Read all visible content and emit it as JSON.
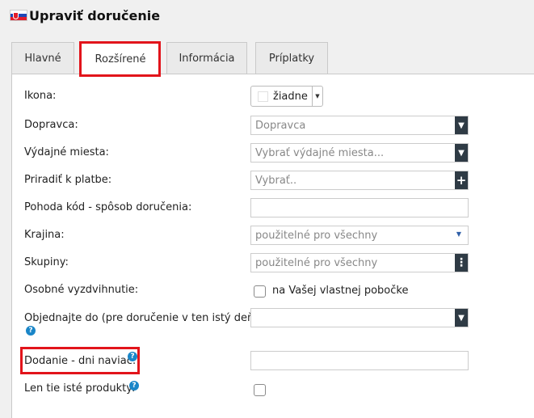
{
  "header": {
    "title": "Upraviť doručenie",
    "flag_icon": "slovakia-flag-icon"
  },
  "tabs": [
    {
      "label": "Hlavné"
    },
    {
      "label": "Rozšírené"
    },
    {
      "label": "Informácia"
    },
    {
      "label": "Príplatky"
    }
  ],
  "fields": {
    "ikona": {
      "label": "Ikona:",
      "value": "žiadne"
    },
    "dopravca": {
      "label": "Dopravca:",
      "value": "Dopravca"
    },
    "vydajne": {
      "label": "Výdajné miesta:",
      "placeholder": "Vybrať výdajné miesta..."
    },
    "priradit": {
      "label": "Priradiť k platbe:",
      "placeholder": "Vybrať.."
    },
    "pohoda": {
      "label": "Pohoda kód - spôsob doručenia:",
      "value": ""
    },
    "krajina": {
      "label": "Krajina:",
      "value": "použitelné pro všechny"
    },
    "skupiny": {
      "label": "Skupiny:",
      "value": "použitelné pro všechny"
    },
    "osobne": {
      "label": "Osobné vyzdvihnutie:",
      "checkbox_label": "na Vašej vlastnej pobočke"
    },
    "objednajte": {
      "label": "Objednajte do (pre doručenie v ten istý deň):",
      "value": ""
    },
    "dodanie": {
      "label": "Dodanie - dni naviac:",
      "value": ""
    },
    "len": {
      "label": "Len tie isté produkty:"
    }
  },
  "colors": {
    "highlight": "#e2141b",
    "help": "#1a86c8",
    "dark_button": "#2f3b45"
  }
}
